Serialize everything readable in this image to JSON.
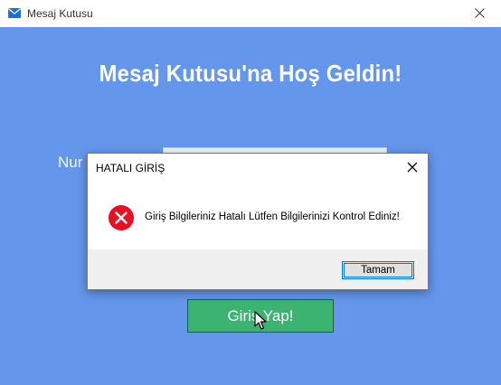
{
  "window": {
    "title": "Mesaj Kutusu",
    "icon": "mail-icon",
    "close_icon": "close-icon"
  },
  "main": {
    "welcome": "Mesaj Kutusu'na Hoş Geldin!",
    "number_label": "Nur",
    "login_button": "Giriş Yap!",
    "background_color": "#6496eb",
    "button_color": "#3cb371"
  },
  "dialog": {
    "title": "HATALI GİRİŞ",
    "message": "Giriş Bilgileriniz Hatalı Lütfen Bilgilerinizi Kontrol Ediniz!",
    "ok_label": "Tamam",
    "icon": "error-icon",
    "error_color": "#e81123"
  }
}
